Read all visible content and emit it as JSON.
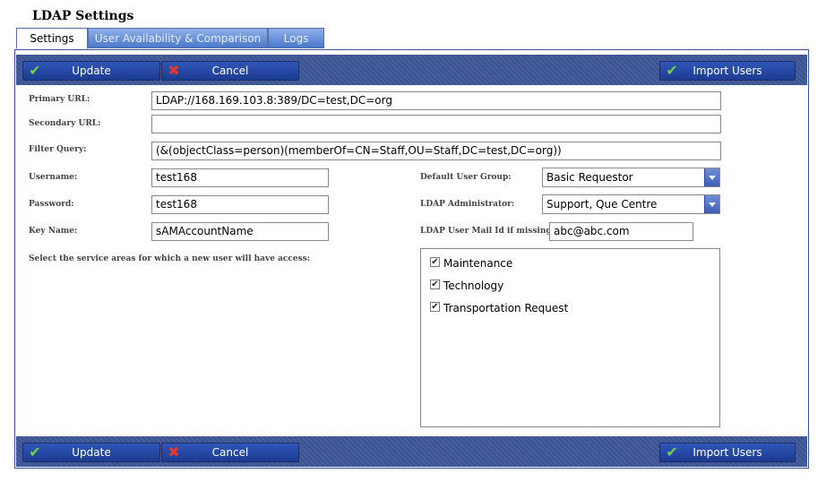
{
  "page": {
    "title": "LDAP Settings"
  },
  "tabs": [
    {
      "label": "Settings",
      "active": true
    },
    {
      "label": "User Availability & Comparison",
      "active": false
    },
    {
      "label": "Logs",
      "active": false
    }
  ],
  "toolbar": {
    "update_label": "Update",
    "cancel_label": "Cancel",
    "import_label": "Import Users",
    "update_icon": "check-icon",
    "cancel_icon": "x-icon",
    "import_icon": "check-icon"
  },
  "form": {
    "primary_url_label": "Primary URL:",
    "primary_url_value": "LDAP://168.169.103.8:389/DC=test,DC=org",
    "secondary_url_label": "Secondary URL:",
    "secondary_url_value": "",
    "filter_query_label": "Filter Query:",
    "filter_query_value": "(&(objectClass=person)(memberOf=CN=Staff,OU=Staff,DC=test,DC=org))",
    "username_label": "Username:",
    "username_value": "test168",
    "password_label": "Password:",
    "password_value": "test168",
    "key_name_label": "Key Name:",
    "key_name_value": "sAMAccountName",
    "default_user_group_label": "Default User Group:",
    "default_user_group_value": "Basic Requestor",
    "ldap_admin_label": "LDAP Administrator:",
    "ldap_admin_value": "Support, Que Centre",
    "mail_id_label": "LDAP User Mail Id if missing:",
    "mail_id_value": "abc@abc.com",
    "service_areas_label": "Select the service areas for which a new user will have access:"
  },
  "service_areas": [
    {
      "label": "Maintenance",
      "checked": true,
      "mark": "✔"
    },
    {
      "label": "Technology",
      "checked": true,
      "mark": "✔"
    },
    {
      "label": "Transportation Request",
      "checked": true,
      "mark": "✔"
    }
  ],
  "colors": {
    "toolbar_bg": "#3a5392",
    "button_bg": "#2f56b8",
    "check_green": "#6fd04a",
    "cancel_red": "#e23b2e",
    "panel_border": "#3a4fa0"
  }
}
